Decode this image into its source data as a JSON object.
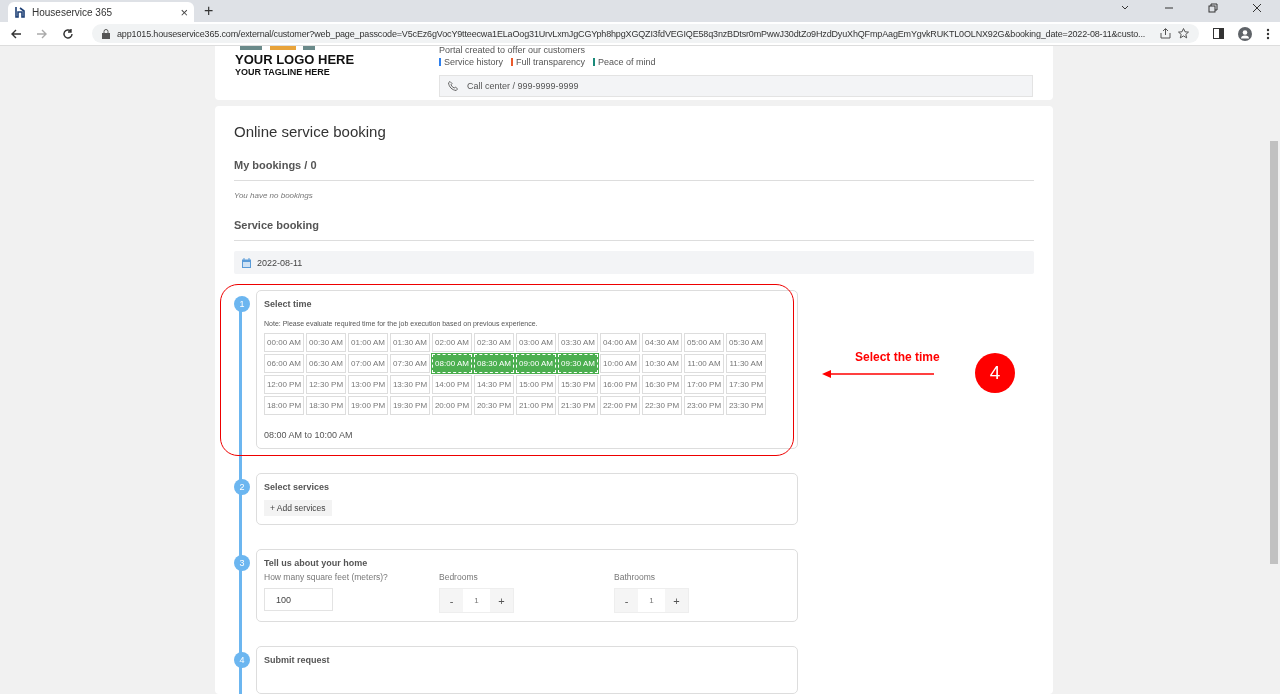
{
  "browser": {
    "tab_title": "Houseservice 365",
    "tab_close": "×",
    "new_tab": "+",
    "url": "app1015.houseservice365.com/external/customer?web_page_passcode=V5cEz6gVocY9tteecwa1ELaOog31UrvLxmJgCGYph8hpgXGQZI3fdVEGIQE58q3nzBDtsr0mPwwJ30dtZo9HzdDyuXhQFmpAagEmYgvkRUKTL0OLNX92G&booking_date=2022-08-11&custo..."
  },
  "header": {
    "logo_title": "YOUR LOGO HERE",
    "logo_tagline": "YOUR TAGLINE HERE",
    "intro": "Portal created to offer our customers",
    "features": [
      {
        "label": "Service history",
        "color": "#2f80ed"
      },
      {
        "label": "Full transparency",
        "color": "#eb5a2c"
      },
      {
        "label": "Peace of mind",
        "color": "#1a8a7a"
      }
    ],
    "call_center": "Call center / 999-9999-9999"
  },
  "booking": {
    "title": "Online service booking",
    "my_bookings": "My bookings / 0",
    "no_bookings": "You have no bookings",
    "service_booking": "Service booking",
    "date": "2022-08-11"
  },
  "steps": [
    {
      "kind": "time",
      "number": "1",
      "title": "Select time",
      "note": "Note: Please evaluate required time for the job execution based on previous experience.",
      "slots": [
        {
          "label": "00:00 AM",
          "selected": false
        },
        {
          "label": "00:30 AM",
          "selected": false
        },
        {
          "label": "01:00 AM",
          "selected": false
        },
        {
          "label": "01:30 AM",
          "selected": false
        },
        {
          "label": "02:00 AM",
          "selected": false
        },
        {
          "label": "02:30 AM",
          "selected": false
        },
        {
          "label": "03:00 AM",
          "selected": false
        },
        {
          "label": "03:30 AM",
          "selected": false
        },
        {
          "label": "04:00 AM",
          "selected": false
        },
        {
          "label": "04:30 AM",
          "selected": false
        },
        {
          "label": "05:00 AM",
          "selected": false
        },
        {
          "label": "05:30 AM",
          "selected": false
        },
        {
          "label": "06:00 AM",
          "selected": false
        },
        {
          "label": "06:30 AM",
          "selected": false
        },
        {
          "label": "07:00 AM",
          "selected": false
        },
        {
          "label": "07:30 AM",
          "selected": false
        },
        {
          "label": "08:00 AM",
          "selected": true
        },
        {
          "label": "08:30 AM",
          "selected": true
        },
        {
          "label": "09:00 AM",
          "selected": true
        },
        {
          "label": "09:30 AM",
          "selected": true
        },
        {
          "label": "10:00 AM",
          "selected": false
        },
        {
          "label": "10:30 AM",
          "selected": false
        },
        {
          "label": "11:00 AM",
          "selected": false
        },
        {
          "label": "11:30 AM",
          "selected": false
        },
        {
          "label": "12:00 PM",
          "selected": false
        },
        {
          "label": "12:30 PM",
          "selected": false
        },
        {
          "label": "13:00 PM",
          "selected": false
        },
        {
          "label": "13:30 PM",
          "selected": false
        },
        {
          "label": "14:00 PM",
          "selected": false
        },
        {
          "label": "14:30 PM",
          "selected": false
        },
        {
          "label": "15:00 PM",
          "selected": false
        },
        {
          "label": "15:30 PM",
          "selected": false
        },
        {
          "label": "16:00 PM",
          "selected": false
        },
        {
          "label": "16:30 PM",
          "selected": false
        },
        {
          "label": "17:00 PM",
          "selected": false
        },
        {
          "label": "17:30 PM",
          "selected": false
        },
        {
          "label": "18:00 PM",
          "selected": false
        },
        {
          "label": "18:30 PM",
          "selected": false
        },
        {
          "label": "19:00 PM",
          "selected": false
        },
        {
          "label": "19:30 PM",
          "selected": false
        },
        {
          "label": "20:00 PM",
          "selected": false
        },
        {
          "label": "20:30 PM",
          "selected": false
        },
        {
          "label": "21:00 PM",
          "selected": false
        },
        {
          "label": "21:30 PM",
          "selected": false
        },
        {
          "label": "22:00 PM",
          "selected": false
        },
        {
          "label": "22:30 PM",
          "selected": false
        },
        {
          "label": "23:00 PM",
          "selected": false
        },
        {
          "label": "23:30 PM",
          "selected": false
        }
      ],
      "summary": "08:00 AM to 10:00 AM"
    },
    {
      "kind": "services",
      "number": "2",
      "title": "Select services",
      "button": "+ Add services"
    },
    {
      "kind": "home",
      "number": "3",
      "title": "Tell us about your home",
      "area_label": "How many square feet (meters)?",
      "area_value": "100",
      "counters": [
        {
          "label": "Bedrooms",
          "minus": "-",
          "value": "1",
          "plus": "+"
        },
        {
          "label": "Bathrooms",
          "minus": "-",
          "value": "1",
          "plus": "+"
        }
      ]
    },
    {
      "kind": "submit",
      "number": "4",
      "title": "Submit request"
    }
  ],
  "annotation": {
    "text": "Select the time",
    "number": "4"
  }
}
